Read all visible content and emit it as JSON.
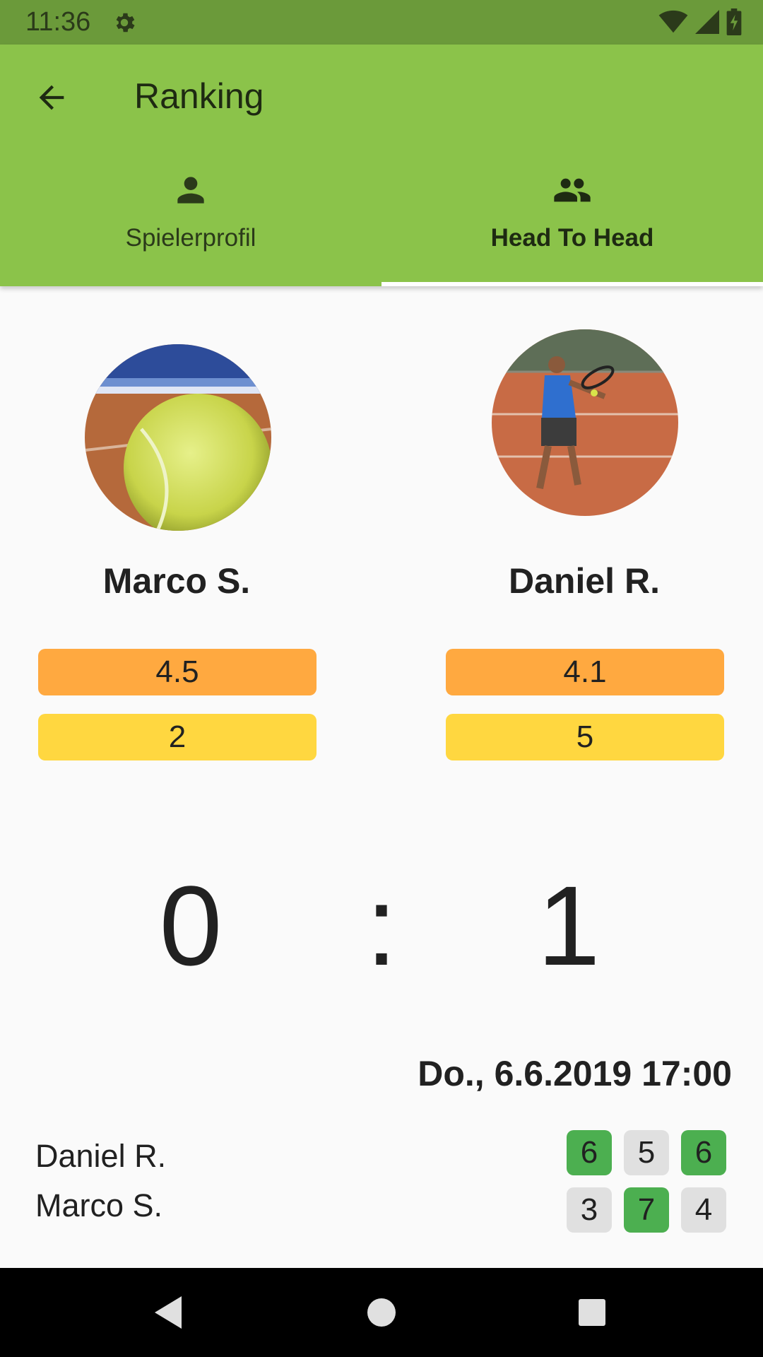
{
  "status_bar": {
    "time": "11:36",
    "icons": [
      "settings-icon",
      "wifi-icon",
      "signal-icon",
      "battery-icon"
    ]
  },
  "app_bar": {
    "title": "Ranking",
    "back_icon": "arrow-back-icon",
    "color": "#8BC34A"
  },
  "tabs": [
    {
      "label": "Spielerprofil",
      "icon": "person-icon",
      "selected": false
    },
    {
      "label": "Head To Head",
      "icon": "people-icon",
      "selected": true
    }
  ],
  "players": [
    {
      "name": "Marco S.",
      "avatar": "tennis-ball-photo",
      "rating": "4.5",
      "rank": "2"
    },
    {
      "name": "Daniel R.",
      "avatar": "tennis-player-photo",
      "rating": "4.1",
      "rank": "5"
    }
  ],
  "score": {
    "left": "0",
    "separator": ":",
    "right": "1"
  },
  "match": {
    "date": "Do., 6.6.2019 17:00",
    "rows": [
      {
        "name": "Daniel R.",
        "sets": [
          {
            "value": "6",
            "won": true
          },
          {
            "value": "5",
            "won": false
          },
          {
            "value": "6",
            "won": true
          }
        ]
      },
      {
        "name": "Marco S.",
        "sets": [
          {
            "value": "3",
            "won": false
          },
          {
            "value": "7",
            "won": true
          },
          {
            "value": "4",
            "won": false
          }
        ]
      }
    ]
  },
  "colors": {
    "rating_badge": "#FFA940",
    "rank_badge": "#FFD740",
    "set_won": "#4CAF50",
    "set_lost": "#E0E0E0"
  },
  "nav_bar": {
    "icons": [
      "back-triangle-icon",
      "home-circle-icon",
      "recents-square-icon"
    ]
  }
}
